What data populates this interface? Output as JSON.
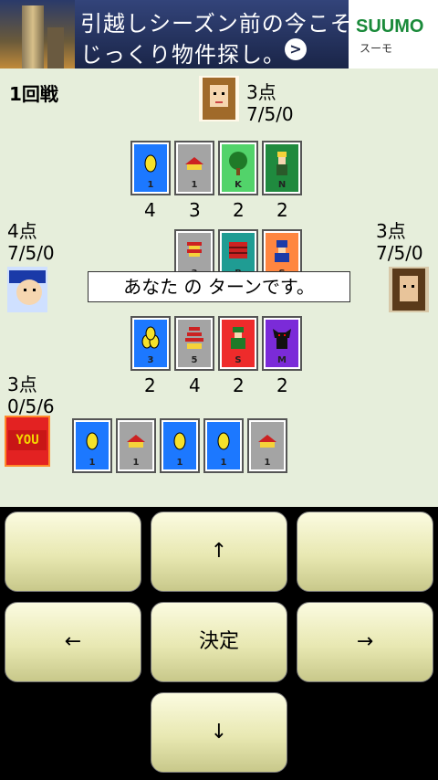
{
  "ad": {
    "line1": "引越しシーズン前の今こそ",
    "line2": "じっくり物件探し。",
    "arrow": ">",
    "brand": "SUUMO",
    "brand_sub": "スーモ"
  },
  "game": {
    "round": "1回戦",
    "message": "あなた の ターンです。",
    "top_player": {
      "score": "3点",
      "stats": "7/5/0",
      "counts": [
        "4",
        "3",
        "2",
        "2"
      ]
    },
    "left_player": {
      "score": "4点",
      "stats": "7/5/0"
    },
    "right_player": {
      "score": "3点",
      "stats": "7/5/0"
    },
    "mid_counts": [
      "2",
      "4",
      "2",
      "2"
    ],
    "you": {
      "score": "3点",
      "stats": "0/5/6",
      "badge": "YOU"
    },
    "top_cards": [
      {
        "color": "blue",
        "icon": "coin-icon",
        "label": "1"
      },
      {
        "color": "gray",
        "icon": "house-icon",
        "label": "1"
      },
      {
        "color": "green",
        "icon": "tree-icon",
        "label": "K"
      },
      {
        "color": "green",
        "icon": "soldier-icon",
        "label": "N"
      }
    ],
    "center_cards": [
      {
        "color": "gray",
        "icon": "tower-icon",
        "label": "3"
      },
      {
        "color": "teal",
        "icon": "wall-icon",
        "label": "B"
      },
      {
        "color": "orange",
        "icon": "knight-icon",
        "label": "S"
      }
    ],
    "mid_cards": [
      {
        "color": "blue",
        "icon": "coins-icon",
        "label": "3"
      },
      {
        "color": "gray",
        "icon": "pagoda-icon",
        "label": "5"
      },
      {
        "color": "red",
        "icon": "warrior-icon",
        "label": "S"
      },
      {
        "color": "purple",
        "icon": "demon-icon",
        "label": "M"
      }
    ],
    "hand_cards": [
      {
        "color": "blue",
        "icon": "coin-icon",
        "label": "1"
      },
      {
        "color": "gray",
        "icon": "house-icon",
        "label": "1"
      },
      {
        "color": "blue",
        "icon": "coin-icon",
        "label": "1"
      },
      {
        "color": "blue",
        "icon": "coin-icon",
        "label": "1"
      },
      {
        "color": "gray",
        "icon": "house-icon",
        "label": "1"
      }
    ]
  },
  "controls": {
    "up": "↑",
    "left": "←",
    "ok": "決定",
    "right": "→",
    "down": "↓"
  }
}
